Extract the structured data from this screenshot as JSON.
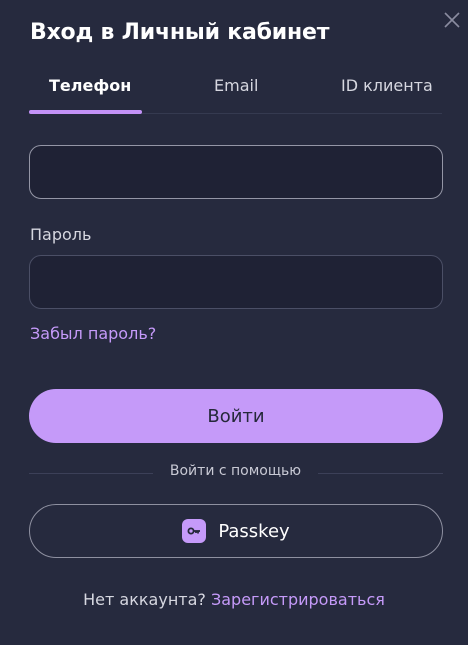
{
  "header": {
    "title": "Вход в Личный кабинет"
  },
  "tabs": [
    {
      "label": "Телефон",
      "active": true
    },
    {
      "label": "Email",
      "active": false
    },
    {
      "label": "ID клиента",
      "active": false
    }
  ],
  "form": {
    "phone_value": "",
    "password_label": "Пароль",
    "password_value": "",
    "forgot_label": "Забыл пароль?",
    "login_label": "Войти"
  },
  "alt_login": {
    "separator_text": "Войти с помощью",
    "passkey_label": "Passkey"
  },
  "footer": {
    "no_account_text": "Нет аккаунта?",
    "register_label": "Зарегистрироваться"
  },
  "colors": {
    "background": "#262a3e",
    "accent": "#c59af9",
    "input_bg": "#1f2235"
  },
  "icons": [
    "close-icon",
    "key-icon"
  ]
}
